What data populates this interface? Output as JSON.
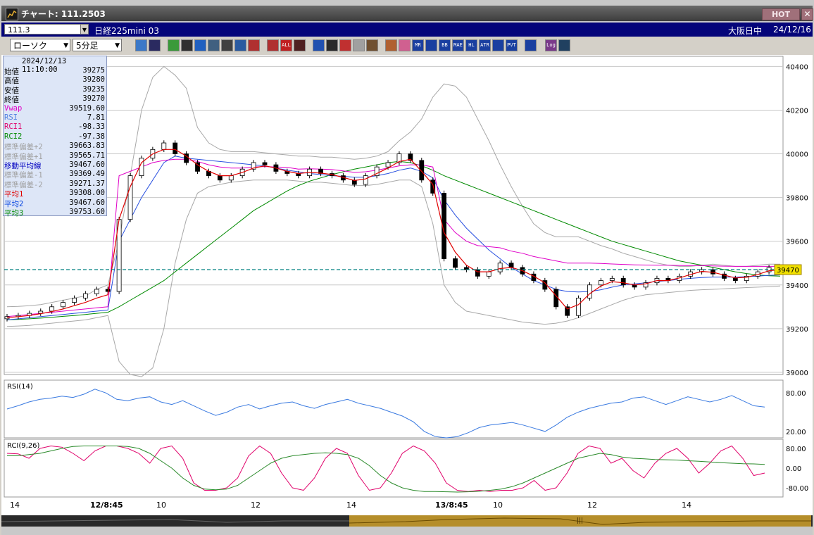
{
  "window": {
    "title": "チャート: 111.2503",
    "hot_label": "HOT",
    "close_label": "✕"
  },
  "infobar": {
    "symbol_code": "111.3",
    "symbol_name": "日経225mini 03",
    "session": "大阪日中",
    "date": "24/12/16"
  },
  "toolbar": {
    "chart_type": "ローソク",
    "interval": "5分足",
    "icons": [
      "zoom-icon",
      "crosshair-icon",
      "pen-icon",
      "trend-icon",
      "cursor-icon",
      "fill-icon",
      "page-icon",
      "trash-icon",
      "candle-icon",
      "candle2-icon",
      "all-icon",
      "marker-icon",
      "search-icon",
      "bar-icon",
      "scale-icon",
      "window-icon",
      "settings-icon",
      "tools-icon",
      "color-icon",
      "vol-icon",
      "ma-icon",
      "bb-icon",
      "mae-icon",
      "hl-icon",
      "atr-icon",
      "rci-icon",
      "pvt-icon",
      "frame-icon",
      "log-icon",
      "export-icon"
    ],
    "icon_labels": {
      "all": "ALL",
      "mr": "MR",
      "bb": "BB",
      "mae": "MAE",
      "hl": "HL",
      "atr": "ATR",
      "pvt": "PVT",
      "log": "Log"
    }
  },
  "legend": {
    "timestamp": "2024/12/13  11:10:00",
    "rows": [
      {
        "k": "始値",
        "v": "39275",
        "color": "#000000"
      },
      {
        "k": "高値",
        "v": "39280",
        "color": "#000000"
      },
      {
        "k": "安値",
        "v": "39235",
        "color": "#000000"
      },
      {
        "k": "終値",
        "v": "39270",
        "color": "#000000"
      },
      {
        "k": "Vwap",
        "v": "39519.60",
        "color": "#e000c8"
      },
      {
        "k": "RSI",
        "v": "7.81",
        "color": "#5080e0"
      },
      {
        "k": "RCI1",
        "v": "-98.33",
        "color": "#e0006a"
      },
      {
        "k": "RCI2",
        "v": "-97.38",
        "color": "#008a00"
      },
      {
        "k": "標準偏差+2",
        "v": "39663.83",
        "color": "#a0a0a0"
      },
      {
        "k": "標準偏差+1",
        "v": "39565.71",
        "color": "#a0a0a0"
      },
      {
        "k": "移動平均線",
        "v": "39467.60",
        "color": "#0000c0"
      },
      {
        "k": "標準偏差-1",
        "v": "39369.49",
        "color": "#a0a0a0"
      },
      {
        "k": "標準偏差-2",
        "v": "39271.37",
        "color": "#a0a0a0"
      },
      {
        "k": "平均1",
        "v": "39308.00",
        "color": "#e00000"
      },
      {
        "k": "平均2",
        "v": "39467.60",
        "color": "#0040e0"
      },
      {
        "k": "平均3",
        "v": "39753.60",
        "color": "#008a00"
      }
    ]
  },
  "chart_data": [
    {
      "type": "candlestick",
      "panel": "price",
      "y_ticks": [
        "40400",
        "40200",
        "40000",
        "39800",
        "39600",
        "39400",
        "39200",
        "39000"
      ],
      "ylim": [
        38990,
        40440
      ],
      "current_price": "39470",
      "x_ticks": [
        "14",
        "12/8:45",
        "10",
        "12",
        "14",
        "13/8:45",
        "10",
        "12",
        "14"
      ],
      "colors": {
        "up": "#ffffff",
        "down": "#000000",
        "vwap": "#e000c8",
        "ma": "#2850e0",
        "avg1": "#e00000",
        "avg3": "#008a00",
        "band": "#a8a8a8",
        "price_line": "#008080"
      },
      "close": [
        39255,
        39260,
        39270,
        39280,
        39300,
        39320,
        39340,
        39360,
        39380,
        39370,
        39700,
        39900,
        39980,
        40020,
        40050,
        40000,
        39960,
        39920,
        39900,
        39880,
        39900,
        39930,
        39960,
        39950,
        39920,
        39910,
        39900,
        39930,
        39910,
        39900,
        39880,
        39860,
        39900,
        39940,
        39960,
        40000,
        39970,
        39880,
        39820,
        39520,
        39480,
        39470,
        39440,
        39460,
        39500,
        39480,
        39450,
        39420,
        39380,
        39300,
        39260,
        39340,
        39400,
        39420,
        39430,
        39400,
        39390,
        39410,
        39430,
        39420,
        39440,
        39460,
        39470,
        39450,
        39430,
        39420,
        39440,
        39460,
        39480,
        39470
      ],
      "vwap": [
        39255,
        39260,
        39265,
        39270,
        39275,
        39280,
        39285,
        39290,
        39295,
        39300,
        39900,
        39920,
        39940,
        39960,
        39970,
        39975,
        39975,
        39965,
        39950,
        39940,
        39935,
        39935,
        39940,
        39942,
        39940,
        39938,
        39930,
        39932,
        39930,
        39928,
        39922,
        39915,
        39918,
        39925,
        39935,
        39945,
        39950,
        39950,
        39940,
        39700,
        39640,
        39600,
        39580,
        39575,
        39570,
        39555,
        39545,
        39530,
        39520,
        39510,
        39500,
        39500,
        39500,
        39498,
        39496,
        39494,
        39492,
        39491,
        39490,
        39490,
        39489,
        39488,
        39488,
        39487,
        39486,
        39485,
        39485,
        39485,
        39485,
        39485
      ],
      "ma": [
        39240,
        39245,
        39250,
        39255,
        39260,
        39265,
        39270,
        39275,
        39280,
        39285,
        39600,
        39700,
        39800,
        39880,
        39960,
        39990,
        39980,
        39975,
        39970,
        39965,
        39960,
        39955,
        39950,
        39945,
        39935,
        39925,
        39918,
        39910,
        39905,
        39900,
        39897,
        39893,
        39893,
        39900,
        39910,
        39925,
        39935,
        39920,
        39890,
        39790,
        39720,
        39660,
        39610,
        39560,
        39520,
        39480,
        39450,
        39420,
        39400,
        39380,
        39370,
        39368,
        39370,
        39378,
        39390,
        39400,
        39405,
        39410,
        39416,
        39420,
        39426,
        39430,
        39434,
        39436,
        39436,
        39436,
        39438,
        39440,
        39444,
        39446
      ],
      "avg1": [
        39250,
        39255,
        39260,
        39268,
        39278,
        39290,
        39305,
        39320,
        39340,
        39355,
        39700,
        39850,
        39960,
        40000,
        40020,
        40020,
        39990,
        39950,
        39920,
        39900,
        39900,
        39915,
        39935,
        39945,
        39935,
        39920,
        39910,
        39915,
        39912,
        39905,
        39892,
        39878,
        39885,
        39910,
        39935,
        39965,
        39975,
        39920,
        39860,
        39640,
        39550,
        39490,
        39460,
        39460,
        39475,
        39480,
        39465,
        39440,
        39410,
        39350,
        39290,
        39310,
        39360,
        39395,
        39415,
        39410,
        39400,
        39405,
        39420,
        39420,
        39432,
        39448,
        39462,
        39458,
        39445,
        39432,
        39435,
        39448,
        39465,
        39470
      ],
      "avg3": [
        39240,
        39242,
        39245,
        39248,
        39252,
        39256,
        39260,
        39265,
        39270,
        39275,
        39300,
        39330,
        39360,
        39390,
        39420,
        39460,
        39500,
        39540,
        39580,
        39620,
        39660,
        39700,
        39740,
        39770,
        39800,
        39830,
        39855,
        39875,
        39890,
        39905,
        39918,
        39930,
        39940,
        39950,
        39960,
        39965,
        39960,
        39945,
        39925,
        39900,
        39880,
        39860,
        39840,
        39820,
        39800,
        39780,
        39760,
        39740,
        39720,
        39700,
        39680,
        39660,
        39640,
        39620,
        39600,
        39585,
        39570,
        39555,
        39540,
        39525,
        39510,
        39500,
        39490,
        39480,
        39470,
        39460,
        39452,
        39446,
        39442,
        39440
      ],
      "upper": [
        39300,
        39302,
        39305,
        39310,
        39320,
        39330,
        39340,
        39350,
        39380,
        39400,
        39600,
        39900,
        40200,
        40350,
        40400,
        40360,
        40300,
        40120,
        40050,
        40020,
        40010,
        40010,
        40010,
        40005,
        40000,
        39995,
        39990,
        39990,
        39985,
        39985,
        39980,
        39975,
        39980,
        39990,
        40010,
        40060,
        40100,
        40160,
        40260,
        40320,
        40310,
        40260,
        40160,
        40060,
        39950,
        39850,
        39760,
        39680,
        39640,
        39620,
        39620,
        39620,
        39600,
        39580,
        39565,
        39545,
        39530,
        39515,
        39500,
        39490,
        39485,
        39485,
        39490,
        39495,
        39490,
        39485,
        39485,
        39490,
        39495,
        39495
      ],
      "lower": [
        39210,
        39212,
        39215,
        39220,
        39225,
        39230,
        39235,
        39240,
        39250,
        39260,
        39050,
        38990,
        38980,
        39020,
        39200,
        39500,
        39700,
        39820,
        39850,
        39860,
        39870,
        39875,
        39880,
        39880,
        39880,
        39880,
        39875,
        39870,
        39870,
        39865,
        39860,
        39855,
        39855,
        39860,
        39870,
        39880,
        39880,
        39850,
        39680,
        39400,
        39320,
        39280,
        39270,
        39260,
        39250,
        39240,
        39230,
        39225,
        39220,
        39225,
        39235,
        39250,
        39270,
        39290,
        39310,
        39330,
        39345,
        39355,
        39360,
        39365,
        39370,
        39375,
        39378,
        39380,
        39382,
        39385,
        39388,
        39390,
        39392,
        39395
      ]
    },
    {
      "type": "line",
      "panel": "rsi",
      "title": "RSI(14)",
      "y_ticks": [
        "80.00",
        "20.00"
      ],
      "ylim": [
        10,
        100
      ],
      "series": [
        {
          "color": "#3a7ae0",
          "values": [
            55,
            60,
            66,
            70,
            72,
            75,
            73,
            78,
            86,
            80,
            70,
            68,
            72,
            74,
            66,
            62,
            68,
            60,
            52,
            45,
            50,
            58,
            62,
            55,
            60,
            64,
            66,
            60,
            56,
            62,
            66,
            70,
            64,
            60,
            56,
            50,
            44,
            35,
            20,
            12,
            10,
            12,
            18,
            26,
            30,
            32,
            34,
            30,
            25,
            20,
            30,
            42,
            50,
            56,
            60,
            64,
            66,
            72,
            74,
            68,
            62,
            68,
            74,
            70,
            66,
            70,
            76,
            68,
            60,
            58
          ]
        }
      ]
    },
    {
      "type": "line",
      "panel": "rci",
      "title": "RCI(9,26)",
      "y_ticks": [
        "80.00",
        "0.00",
        "-80.00"
      ],
      "ylim": [
        -100,
        100
      ],
      "series": [
        {
          "color": "#e0006a",
          "values": [
            60,
            58,
            40,
            80,
            90,
            85,
            60,
            30,
            70,
            90,
            90,
            80,
            60,
            20,
            80,
            90,
            40,
            -60,
            -90,
            -90,
            -80,
            -40,
            50,
            90,
            60,
            -20,
            -80,
            -90,
            -40,
            40,
            80,
            60,
            -30,
            -90,
            -80,
            -20,
            60,
            90,
            70,
            20,
            -60,
            -90,
            -95,
            -90,
            -95,
            -90,
            -90,
            -80,
            -50,
            -90,
            -80,
            -20,
            60,
            90,
            80,
            20,
            40,
            -10,
            -40,
            20,
            60,
            80,
            40,
            -20,
            20,
            70,
            90,
            40,
            -30,
            -20
          ]
        },
        {
          "color": "#2a8a2a",
          "values": [
            50,
            50,
            55,
            60,
            70,
            80,
            88,
            90,
            90,
            90,
            90,
            88,
            80,
            60,
            30,
            0,
            -40,
            -70,
            -85,
            -88,
            -85,
            -70,
            -40,
            -10,
            20,
            40,
            50,
            55,
            60,
            62,
            60,
            55,
            40,
            10,
            -30,
            -60,
            -80,
            -90,
            -95,
            -95,
            -96,
            -97,
            -96,
            -94,
            -90,
            -85,
            -75,
            -60,
            -40,
            -20,
            0,
            20,
            40,
            50,
            60,
            55,
            45,
            40,
            38,
            35,
            34,
            33,
            30,
            28,
            25,
            22,
            20,
            18,
            17,
            15
          ]
        }
      ]
    }
  ]
}
